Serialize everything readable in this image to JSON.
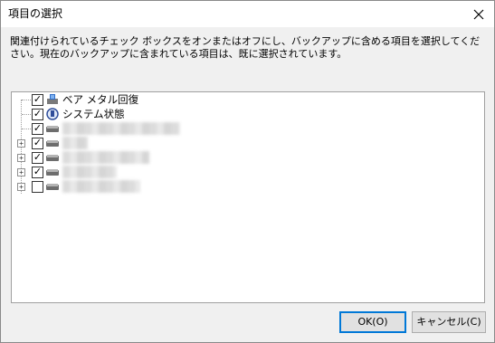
{
  "window": {
    "title": "項目の選択"
  },
  "description": "関連付けられているチェック ボックスをオンまたはオフにし、バックアップに含める項目を選択してください。現在のバックアップに含まれている項目は、既に選択されています。",
  "tree": {
    "items": [
      {
        "label": "ベア メタル回復",
        "checked": true,
        "icon": "bare-metal-recovery-icon"
      },
      {
        "label": "システム状態",
        "checked": true,
        "icon": "system-state-icon"
      },
      {
        "label": "",
        "checked": true,
        "icon": "drive-icon"
      },
      {
        "label": "",
        "checked": true,
        "icon": "drive-icon"
      },
      {
        "label": "",
        "checked": true,
        "icon": "drive-icon"
      },
      {
        "label": "",
        "checked": true,
        "icon": "drive-icon"
      },
      {
        "label": "",
        "checked": false,
        "icon": "drive-icon"
      }
    ]
  },
  "buttons": {
    "ok": "OK(O)",
    "cancel": "キャンセル(C)"
  },
  "colors": {
    "accent": "#0078d7",
    "dialog_bg": "#f0f0f0"
  }
}
